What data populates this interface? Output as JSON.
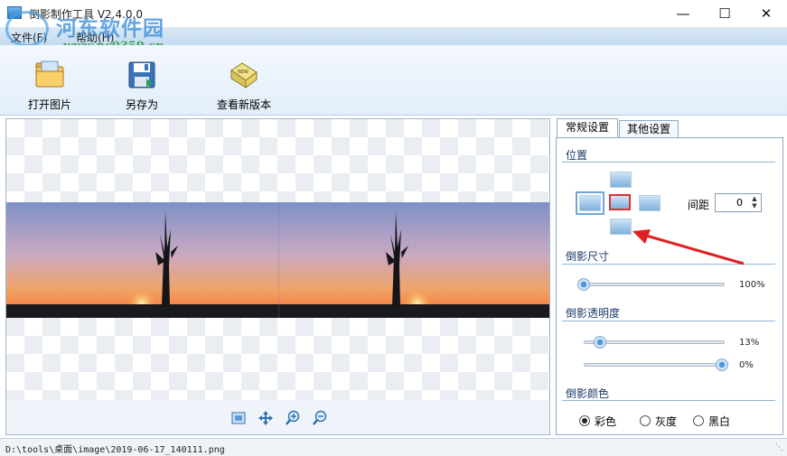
{
  "window": {
    "title": "倒影制作工具 V2.4.0.0"
  },
  "watermark": {
    "name": "河东软件园",
    "url": "www.pc0359.cn"
  },
  "menu": {
    "file": "文件(F)",
    "help": "帮助(H)"
  },
  "toolbar": {
    "open_label": "打开图片",
    "saveas_label": "另存为",
    "version_label": "查看新版本"
  },
  "tabs": {
    "general": "常规设置",
    "other": "其他设置"
  },
  "position": {
    "section_title": "位置",
    "spacing_label": "间距",
    "spacing_value": "0"
  },
  "size": {
    "section_title": "倒影尺寸",
    "value": 100,
    "value_text": "100%"
  },
  "opacity": {
    "section_title": "倒影透明度",
    "start_value": 13,
    "start_text": "13%",
    "end_value": 0,
    "end_text": "0%"
  },
  "color": {
    "section_title": "倒影颜色",
    "options": [
      "彩色",
      "灰度",
      "黑白"
    ],
    "selected": "彩色"
  },
  "status": {
    "path": "D:\\tools\\桌面\\image\\2019-06-17_140111.png"
  },
  "colors": {
    "accent": "#3d8fd8",
    "selected_border": "#e03030",
    "annotation_arrow": "#e02020"
  }
}
